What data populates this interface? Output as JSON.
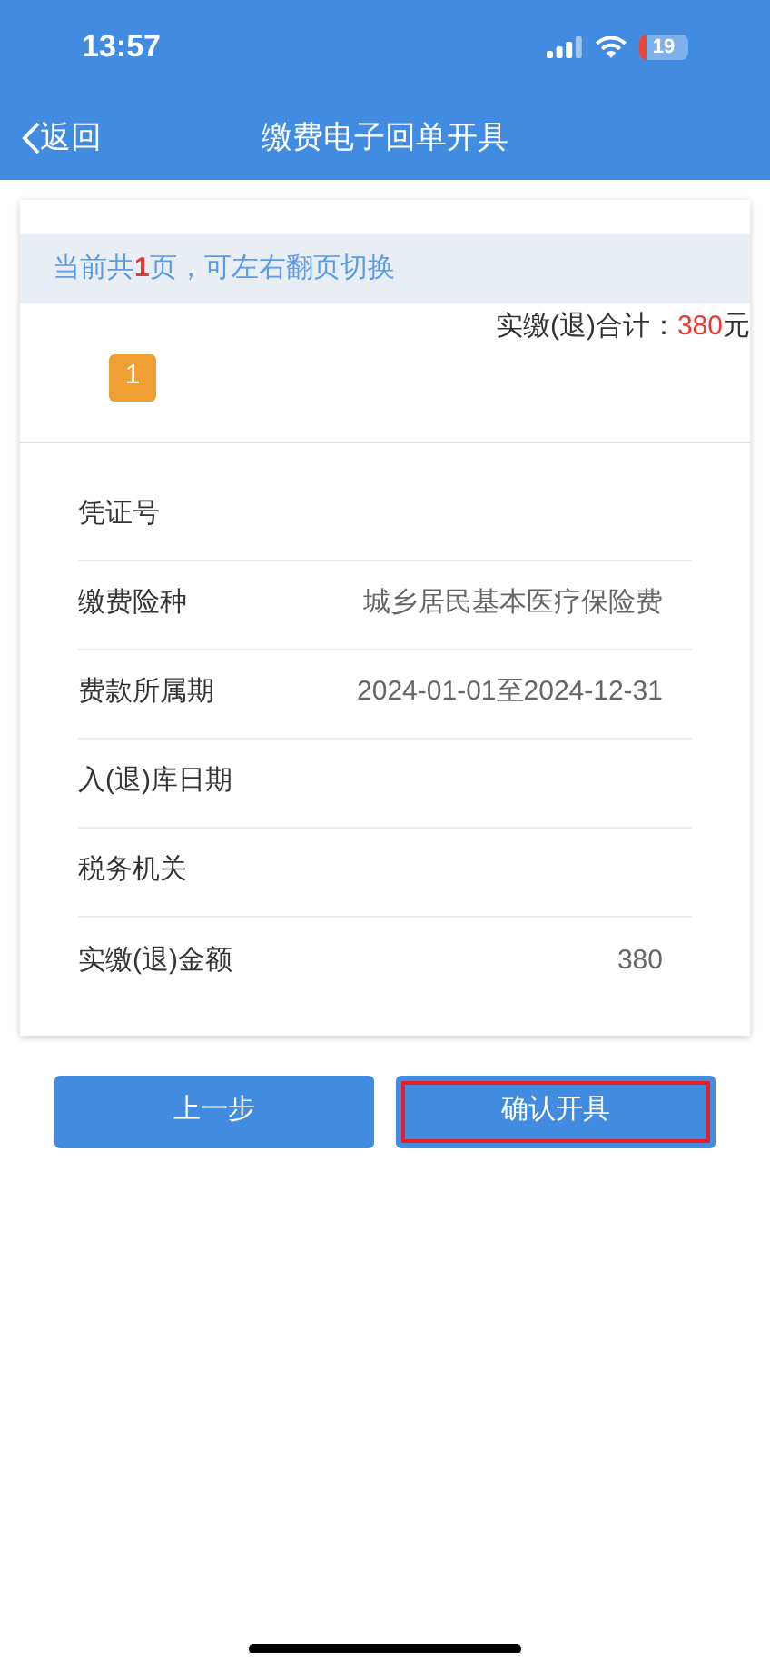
{
  "status_bar": {
    "time": "13:57",
    "battery": "19"
  },
  "nav": {
    "back": "返回",
    "title": "缴费电子回单开具"
  },
  "notice": "当前共**1**页，可左右翻页切换",
  "total": {
    "label": "实缴(退)合计：",
    "amount": "380",
    "unit": "元"
  },
  "pages": [
    {
      "label": "1",
      "selected": true
    }
  ],
  "rows": [
    {
      "label": "凭证号"
    },
    {
      "label": "缴费险种",
      "value": "城乡居民基本医疗保险费"
    },
    {
      "label": "费款所属期",
      "value": "2024-01-01至2024-12-31"
    },
    {
      "label": "入(退)库日期"
    },
    {
      "label": "税务机关"
    },
    {
      "label": "实缴(退)金额",
      "value": "380"
    }
  ],
  "buttons": [
    {
      "label": "上一步",
      "highlighted": false
    },
    {
      "label": "确认开具",
      "highlighted": true
    }
  ]
}
